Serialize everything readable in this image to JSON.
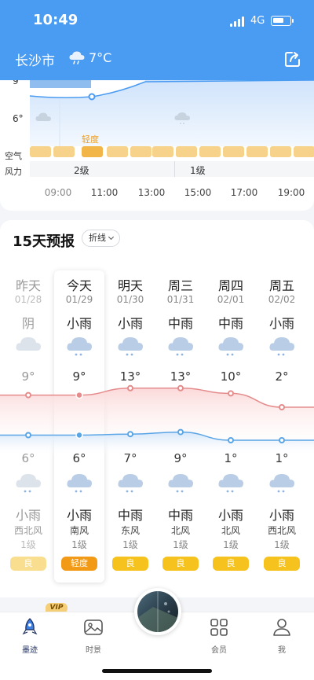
{
  "status": {
    "time": "10:49",
    "network": "4G",
    "battery_level": 0.7
  },
  "header": {
    "city": "长沙市",
    "temp": "7°C",
    "weather_icon": "cloud-rain-icon"
  },
  "hourly": {
    "y_ticks": [
      "9",
      "6°"
    ],
    "air_label": "空气",
    "wind_label": "风力",
    "aq_tag": "轻度",
    "wind_segments": [
      "2级",
      "1级"
    ],
    "times": [
      "09:00",
      "11:00",
      "13:00",
      "15:00",
      "17:00",
      "19:00"
    ]
  },
  "forecast": {
    "title": "15天预报",
    "mode": "折线",
    "days": [
      {
        "name": "昨天",
        "date": "01/28",
        "day_weather": "阴",
        "day_icon": "cloud-icon",
        "high": "9°",
        "low": "6°",
        "night_icon": "cloud-rain-icon",
        "night_weather": "小雨",
        "wind_dir": "西北风",
        "wind_level": "1级",
        "aq": "良",
        "past": true
      },
      {
        "name": "今天",
        "date": "01/29",
        "day_weather": "小雨",
        "day_icon": "cloud-rain-icon",
        "high": "9°",
        "low": "6°",
        "night_icon": "cloud-rain-icon",
        "night_weather": "小雨",
        "wind_dir": "南风",
        "wind_level": "1级",
        "aq": "轻度",
        "today": true
      },
      {
        "name": "明天",
        "date": "01/30",
        "day_weather": "小雨",
        "day_icon": "cloud-rain-icon",
        "high": "13°",
        "low": "7°",
        "night_icon": "cloud-rain-icon",
        "night_weather": "中雨",
        "wind_dir": "东风",
        "wind_level": "1级",
        "aq": "良"
      },
      {
        "name": "周三",
        "date": "01/31",
        "day_weather": "中雨",
        "day_icon": "cloud-rain-icon",
        "high": "13°",
        "low": "9°",
        "night_icon": "cloud-rain-icon",
        "night_weather": "中雨",
        "wind_dir": "北风",
        "wind_level": "1级",
        "aq": "良"
      },
      {
        "name": "周四",
        "date": "02/01",
        "day_weather": "中雨",
        "day_icon": "cloud-rain-icon",
        "high": "10°",
        "low": "1°",
        "night_icon": "cloud-rain-icon",
        "night_weather": "小雨",
        "wind_dir": "北风",
        "wind_level": "1级",
        "aq": "良"
      },
      {
        "name": "周五",
        "date": "02/02",
        "day_weather": "小雨",
        "day_icon": "cloud-rain-icon",
        "high": "2°",
        "low": "1°",
        "night_icon": "cloud-rain-icon",
        "night_weather": "小雨",
        "wind_dir": "西北风",
        "wind_level": "1级",
        "aq": "良"
      }
    ]
  },
  "promo": {
    "vip": "VIP"
  },
  "tabs": [
    {
      "label": "墨迹",
      "icon": "rocket-icon",
      "active": true
    },
    {
      "label": "时景",
      "icon": "photo-icon"
    },
    {
      "label": "会员",
      "icon": "grid-icon"
    },
    {
      "label": "我",
      "icon": "person-icon"
    }
  ],
  "colors": {
    "brand": "#4a9bf2",
    "high_line": "#e58b8b",
    "low_line": "#5aa5e6",
    "aq_good": "#f6c21d",
    "aq_light": "#f29a16"
  }
}
